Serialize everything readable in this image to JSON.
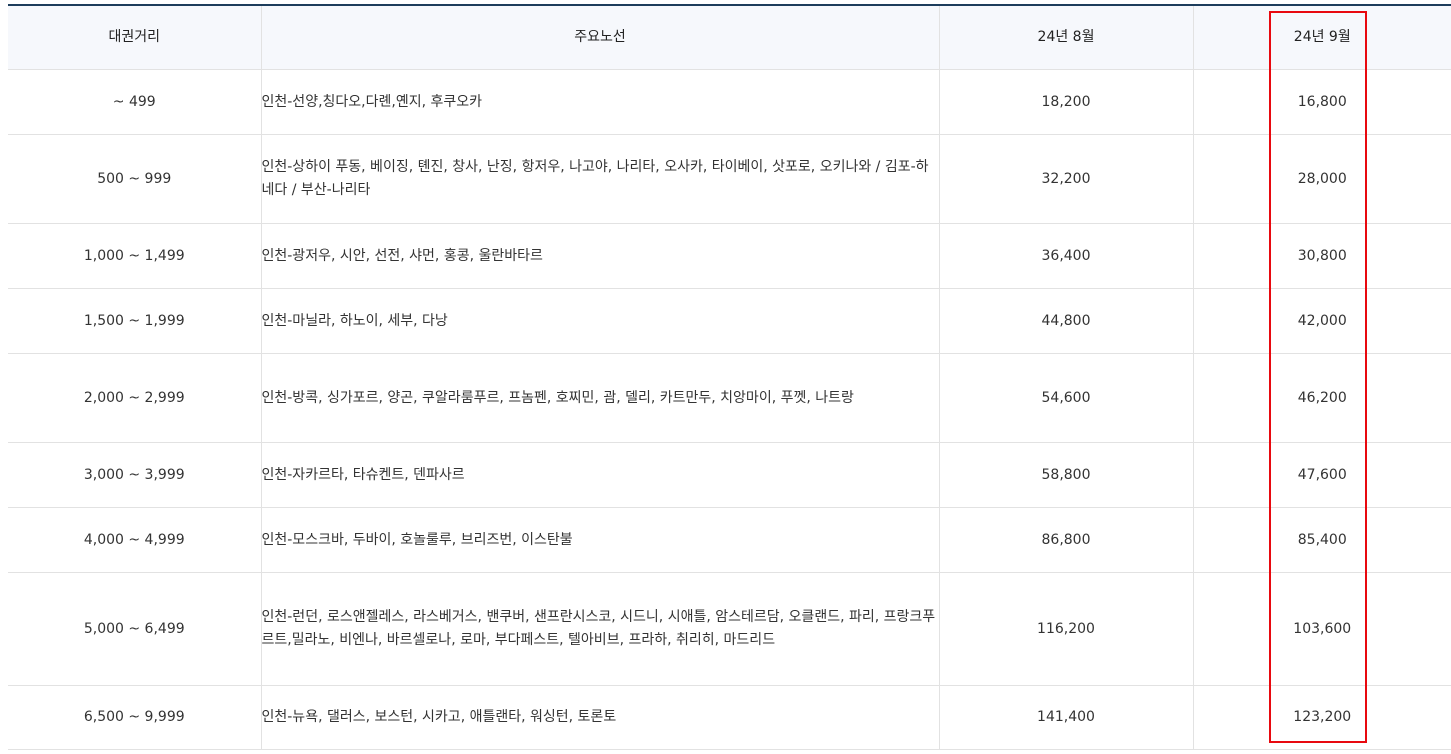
{
  "table": {
    "headers": {
      "distance": "대권거리",
      "routes": "주요노선",
      "aug": "24년 8월",
      "sep": "24년 9월"
    },
    "rows": [
      {
        "distance": "~ 499",
        "routes": "인천-선양,칭다오,다롄,옌지, 후쿠오카",
        "aug": "18,200",
        "sep": "16,800"
      },
      {
        "distance": "500 ~ 999",
        "routes": "인천-상하이 푸동, 베이징, 톈진, 창사, 난징, 항저우, 나고야, 나리타, 오사카, 타이베이, 삿포로, 오키나와 / 김포-하네다 / 부산-나리타",
        "aug": "32,200",
        "sep": "28,000"
      },
      {
        "distance": "1,000 ~ 1,499",
        "routes": "인천-광저우, 시안, 선전, 샤먼, 홍콩, 울란바타르",
        "aug": "36,400",
        "sep": "30,800"
      },
      {
        "distance": "1,500 ~ 1,999",
        "routes": "인천-마닐라, 하노이, 세부, 다낭",
        "aug": "44,800",
        "sep": "42,000"
      },
      {
        "distance": "2,000 ~ 2,999",
        "routes": "인천-방콕, 싱가포르, 양곤, 쿠알라룸푸르, 프놈펜, 호찌민, 괌, 델리, 카트만두, 치앙마이, 푸껫, 나트랑",
        "aug": "54,600",
        "sep": "46,200"
      },
      {
        "distance": "3,000 ~ 3,999",
        "routes": "인천-자카르타, 타슈켄트, 덴파사르",
        "aug": "58,800",
        "sep": "47,600"
      },
      {
        "distance": "4,000 ~ 4,999",
        "routes": "인천-모스크바, 두바이, 호놀룰루, 브리즈번, 이스탄불",
        "aug": "86,800",
        "sep": "85,400"
      },
      {
        "distance": "5,000 ~ 6,499",
        "routes": "인천-런던, 로스앤젤레스, 라스베거스, 밴쿠버, 샌프란시스코, 시드니, 시애틀, 암스테르담, 오클랜드, 파리, 프랑크푸르트,밀라노, 비엔나, 바르셀로나, 로마, 부다페스트, 텔아비브, 프라하, 취리히, 마드리드",
        "aug": "116,200",
        "sep": "103,600"
      },
      {
        "distance": "6,500 ~ 9,999",
        "routes": "인천-뉴욕, 댈러스, 보스턴, 시카고, 애틀랜타, 워싱턴, 토론토",
        "aug": "141,400",
        "sep": "123,200"
      }
    ]
  },
  "colors": {
    "header_background": "#f6f8fc",
    "top_rule": "#1d3d5c",
    "highlight_border": "#e8090f"
  }
}
